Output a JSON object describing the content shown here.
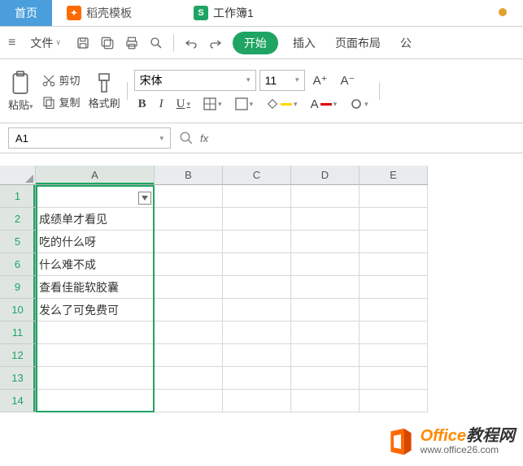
{
  "tabs": {
    "home": "首页",
    "docer": "稻壳模板",
    "docer_icon": "✦",
    "workbook": "工作簿1",
    "workbook_icon": "S"
  },
  "menu": {
    "file": "文件",
    "start": "开始",
    "insert": "插入",
    "page_layout": "页面布局",
    "formula": "公"
  },
  "ribbon": {
    "paste": "粘贴",
    "cut": "剪切",
    "copy": "复制",
    "format_painter": "格式刷",
    "font_name": "宋体",
    "font_size": "11",
    "increase_font": "A⁺",
    "decrease_font": "A⁻",
    "bold": "B",
    "italic": "I",
    "underline": "U",
    "font_color_A": "A"
  },
  "namebox": {
    "value": "A1",
    "fx": "fx"
  },
  "grid": {
    "columns": [
      "A",
      "B",
      "C",
      "D",
      "E"
    ],
    "visible_rows": [
      1,
      2,
      5,
      6,
      9,
      10,
      11,
      12,
      13,
      14
    ],
    "selected_rows": [
      1,
      2,
      5,
      6,
      9,
      10,
      11,
      12,
      13,
      14
    ],
    "cells": {
      "1": "",
      "2": "成绩单才看见",
      "5": "吃的什么呀",
      "6": "什么难不成",
      "9": "查看佳能软胶囊",
      "10": "发么了可免费可",
      "11": "",
      "12": "",
      "13": "",
      "14": ""
    }
  },
  "watermark": {
    "main1": "Office",
    "main2": "教程网",
    "sub": "www.office26.com"
  }
}
